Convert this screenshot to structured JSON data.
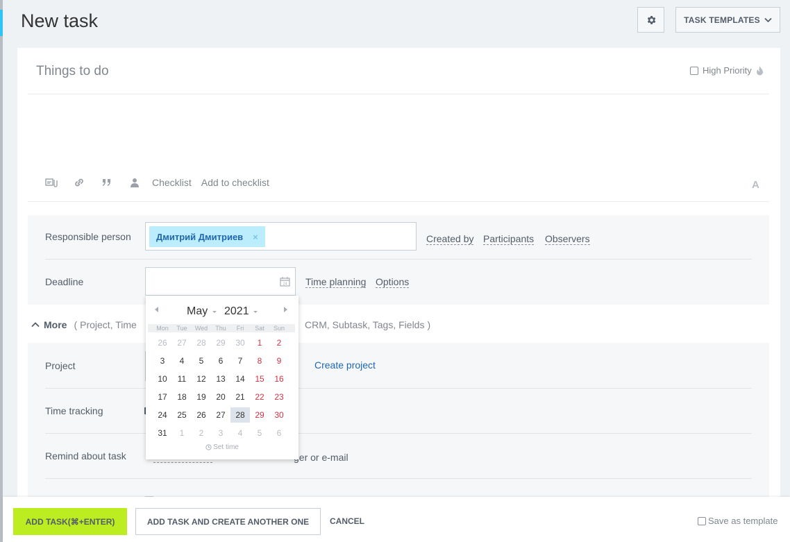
{
  "header": {
    "title": "New task",
    "templates_label": "TASK TEMPLATES"
  },
  "editor": {
    "title_placeholder": "Things to do",
    "high_priority_label": "High Priority",
    "checklist_label": "Checklist",
    "add_checklist_label": "Add to checklist",
    "format_label": "A"
  },
  "responsible": {
    "label": "Responsible person",
    "person": "Дмитрий Дмитриев",
    "remove_glyph": "×",
    "links": [
      "Created by",
      "Participants",
      "Observers"
    ]
  },
  "deadline": {
    "label": "Deadline",
    "links": [
      "Time planning",
      "Options"
    ]
  },
  "more": {
    "label": "More",
    "open": "(",
    "items_visible_left": "Project,  Time",
    "items_visible_right": "CRM,  Subtask,  Tags,  Fields",
    "close": ")"
  },
  "project": {
    "label": "Project",
    "create_label": "Create project"
  },
  "time_tracking": {
    "label": "Time tracking"
  },
  "remind": {
    "label": "Remind about task",
    "tail": "ger or e-mail"
  },
  "calendar": {
    "month": "May",
    "year": "2021",
    "weekdays": [
      "Mon",
      "Tue",
      "Wed",
      "Thu",
      "Fri",
      "Sat",
      "Sun"
    ],
    "weeks": [
      [
        "26",
        "27",
        "28",
        "29",
        "30",
        "1",
        "2"
      ],
      [
        "3",
        "4",
        "5",
        "6",
        "7",
        "8",
        "9"
      ],
      [
        "10",
        "11",
        "12",
        "13",
        "14",
        "15",
        "16"
      ],
      [
        "17",
        "18",
        "19",
        "20",
        "21",
        "22",
        "23"
      ],
      [
        "24",
        "25",
        "26",
        "27",
        "28",
        "29",
        "30"
      ],
      [
        "31",
        "1",
        "2",
        "3",
        "4",
        "5",
        "6"
      ]
    ],
    "today": "28",
    "set_time_label": "Set time",
    "weekend_color": "#d23246"
  },
  "footer": {
    "add_label": "ADD TASK(⌘+ENTER)",
    "add_another_label": "ADD TASK AND CREATE ANOTHER ONE",
    "cancel_label": "CANCEL",
    "save_template_label": "Save as template"
  },
  "colors": {
    "accent_green": "#bbed21",
    "chip_bg": "#bcedfc",
    "link_blue": "#2067b0"
  }
}
